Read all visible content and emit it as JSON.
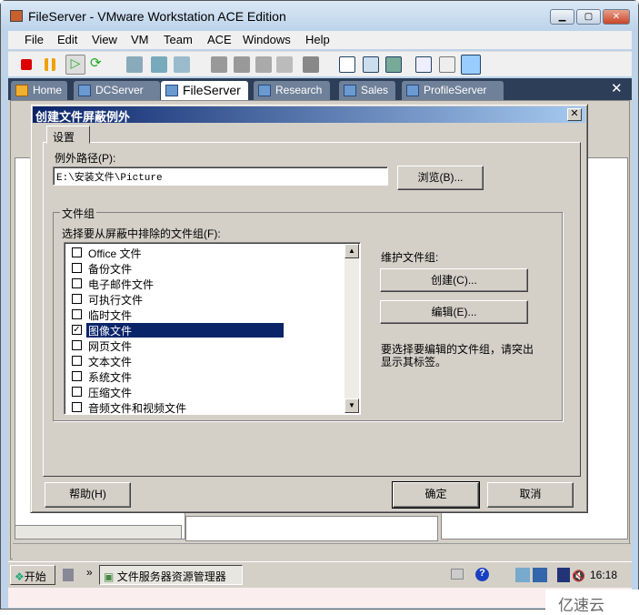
{
  "window": {
    "title": "FileServer - VMware Workstation ACE Edition"
  },
  "menu": [
    "File",
    "Edit",
    "View",
    "VM",
    "Team",
    "ACE",
    "Windows",
    "Help"
  ],
  "tabs": [
    {
      "label": "Home"
    },
    {
      "label": "DCServer"
    },
    {
      "label": "FileServer",
      "active": true
    },
    {
      "label": "Research"
    },
    {
      "label": "Sales"
    },
    {
      "label": "ProfileServer"
    }
  ],
  "dialog": {
    "title": "创建文件屏蔽例外",
    "tab": "设置",
    "path_label": "例外路径(P):",
    "path_value": "E:\\安装文件\\Picture",
    "browse": "浏览(B)...",
    "group_title": "文件组",
    "list_label": "选择要从屏蔽中排除的文件组(F):",
    "items": [
      {
        "label": "Office 文件",
        "checked": false
      },
      {
        "label": "备份文件",
        "checked": false
      },
      {
        "label": "电子邮件文件",
        "checked": false
      },
      {
        "label": "可执行文件",
        "checked": false
      },
      {
        "label": "临时文件",
        "checked": false
      },
      {
        "label": "图像文件",
        "checked": true,
        "selected": true
      },
      {
        "label": "网页文件",
        "checked": false
      },
      {
        "label": "文本文件",
        "checked": false
      },
      {
        "label": "系统文件",
        "checked": false
      },
      {
        "label": "压缩文件",
        "checked": false
      },
      {
        "label": "音频文件和视频文件",
        "checked": false
      }
    ],
    "maintain_label": "维护文件组:",
    "create": "创建(C)...",
    "edit": "编辑(E)...",
    "hint": "要选择要编辑的文件组，请突出显示其标签。",
    "help": "帮助(H)",
    "ok": "确定",
    "cancel": "取消"
  },
  "taskbar": {
    "start": "开始",
    "app": "文件服务器资源管理器",
    "clock": "16:18"
  },
  "watermark": "亿速云"
}
